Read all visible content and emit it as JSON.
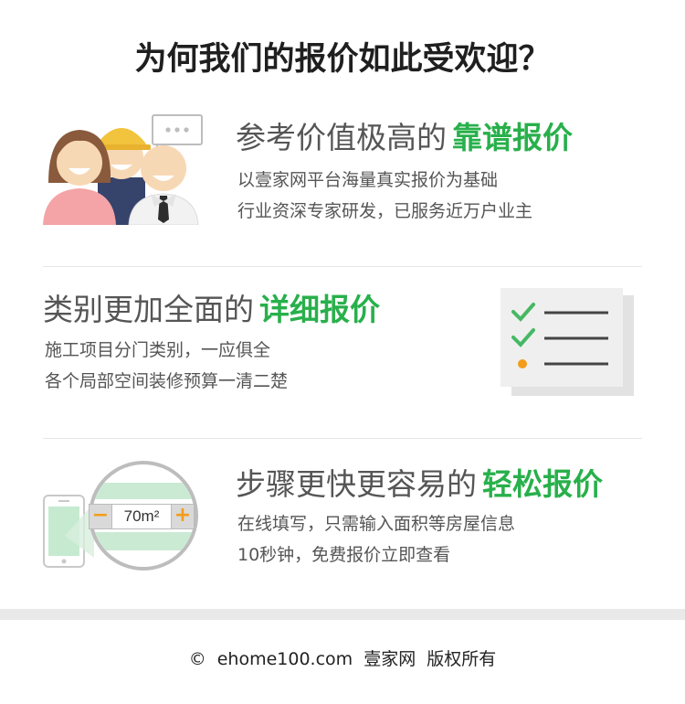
{
  "page_title": "为何我们的报价如此受欢迎？",
  "features": [
    {
      "heading_prefix": "参考价值极高的",
      "heading_highlight": "靠谱报价",
      "lines": [
        "以壹家网平台海量真实报价为基础",
        "行业资深专家研发，已服务近万户业主"
      ],
      "illustration": "people-group-icon"
    },
    {
      "heading_prefix": "类别更加全面的",
      "heading_highlight": "详细报价",
      "lines": [
        "施工项目分门类别，一应俱全",
        "各个局部空间装修预算一清二楚"
      ],
      "illustration": "checklist-icon"
    },
    {
      "heading_prefix": "步骤更快更容易的",
      "heading_highlight": "轻松报价",
      "lines": [
        "在线填写，只需输入面积等房屋信息",
        "10秒钟，免费报价立即查看"
      ],
      "illustration": "phone-magnifier-icon",
      "stepper_value": "70m²",
      "stepper_minus": "−",
      "stepper_plus": "+"
    }
  ],
  "footer": {
    "copyright_symbol": "©",
    "domain": "ehome100.com",
    "site_name": "壹家网",
    "rights": "版权所有"
  },
  "colors": {
    "accent_green": "#28b04b",
    "stepper_orange": "#f39c19"
  }
}
